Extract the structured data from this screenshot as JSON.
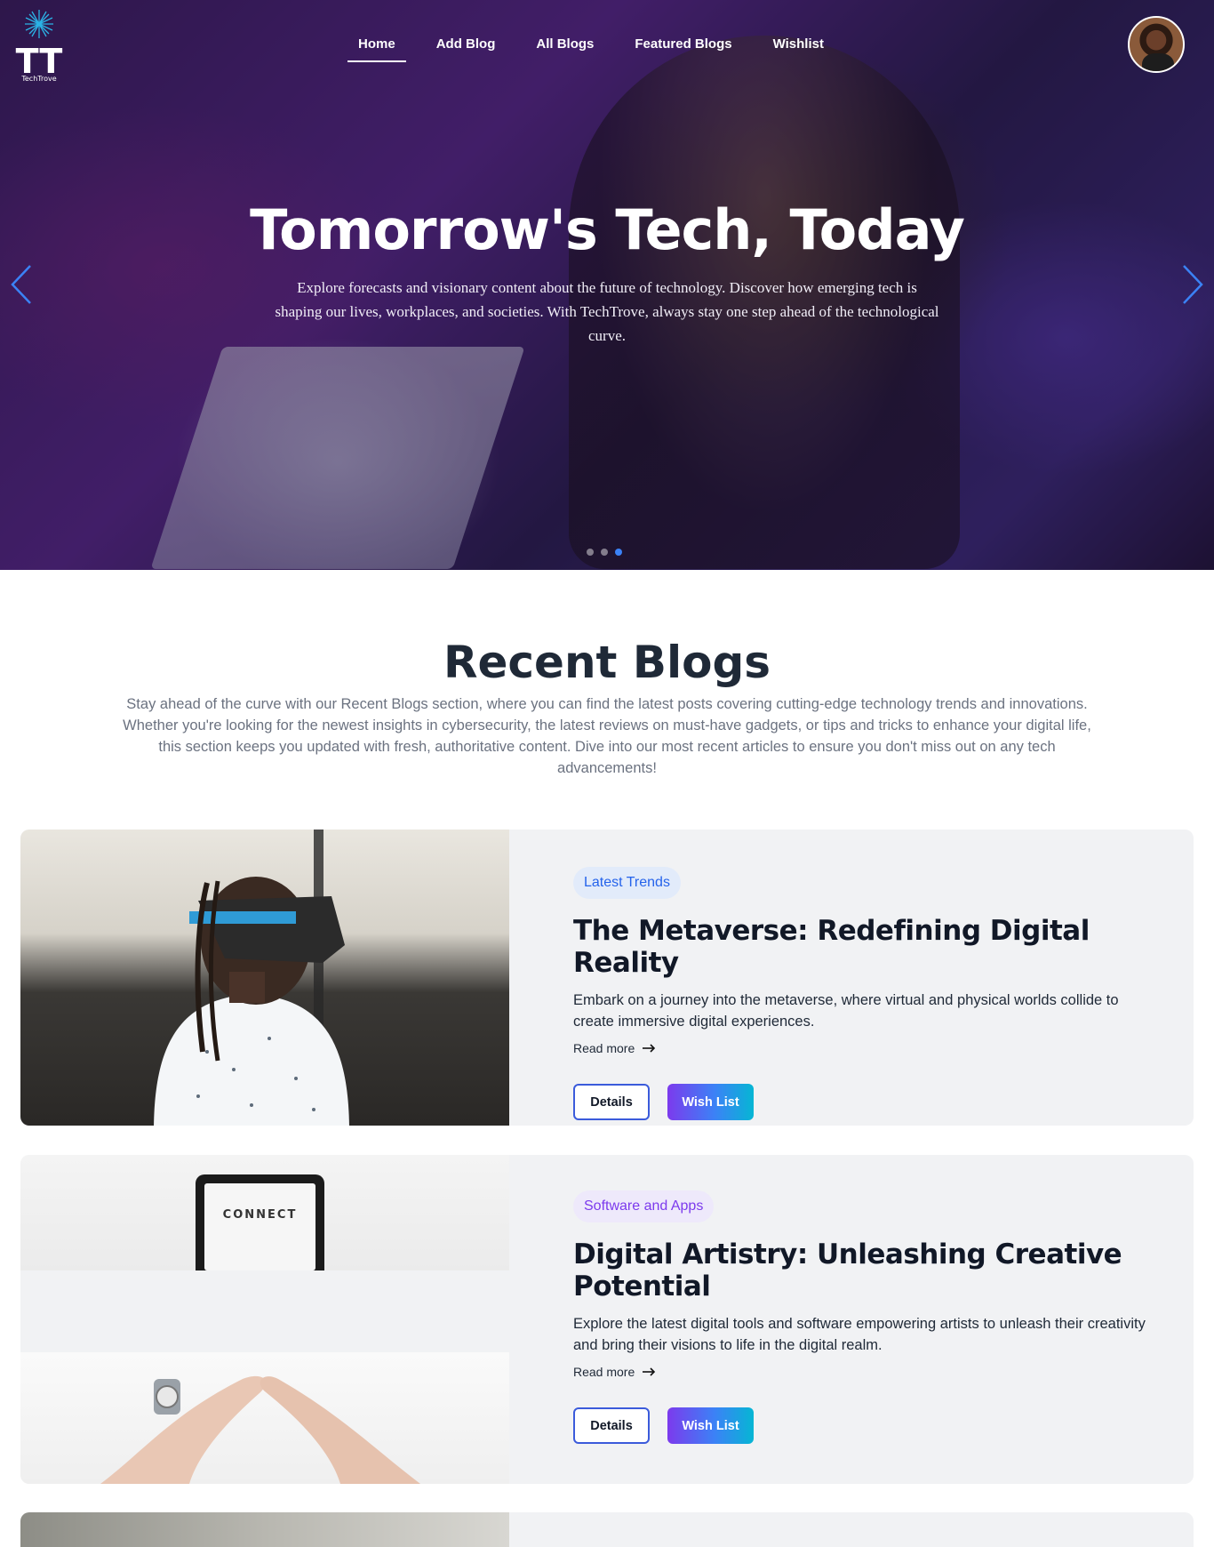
{
  "header": {
    "logo_text": "TT",
    "logo_subtext": "TechTrove",
    "nav": [
      {
        "label": "Home"
      },
      {
        "label": "Add Blog"
      },
      {
        "label": "All Blogs"
      },
      {
        "label": "Featured Blogs"
      },
      {
        "label": "Wishlist"
      }
    ],
    "active_nav": "Home"
  },
  "hero": {
    "title": "Tomorrow's Tech, Today",
    "subtitle": "Explore forecasts and visionary content about the future of technology. Discover how emerging tech is shaping our lives, workplaces, and societies. With TechTrove, always stay one step ahead of the technological curve.",
    "slide_count": 3,
    "active_slide": 3
  },
  "recent": {
    "title": "Recent Blogs",
    "description": "Stay ahead of the curve with our Recent Blogs section, where you can find the latest posts covering cutting-edge technology trends and innovations. Whether you're looking for the newest insights in cybersecurity, the latest reviews on must-have gadgets, or tips and tricks to enhance your digital life, this section keeps you updated with fresh, authoritative content. Dive into our most recent articles to ensure you don't miss out on any tech advancements!",
    "blogs": [
      {
        "category": "Latest Trends",
        "title": "The Metaverse: Redefining Digital Reality",
        "description": "Embark on a journey into the metaverse, where virtual and physical worlds collide to create immersive digital experiences.",
        "read_more": "Read more",
        "details_label": "Details",
        "wishlist_label": "Wish List"
      },
      {
        "category": "Software and Apps",
        "title": "Digital Artistry: Unleashing Creative Potential",
        "description": "Explore the latest digital tools and software empowering artists to unleash their creativity and bring their visions to life in the digital realm.",
        "read_more": "Read more",
        "details_label": "Details",
        "wishlist_label": "Wish List",
        "image_text": "CONNECT"
      }
    ]
  },
  "colors": {
    "accent_blue": "#3b82f6",
    "tag_blue_text": "#2563eb",
    "tag_purple_text": "#7c3aed",
    "card_bg": "#f1f2f4",
    "wishlist_gradient": [
      "#7c3aed",
      "#3b82f6",
      "#06b6d4"
    ]
  }
}
